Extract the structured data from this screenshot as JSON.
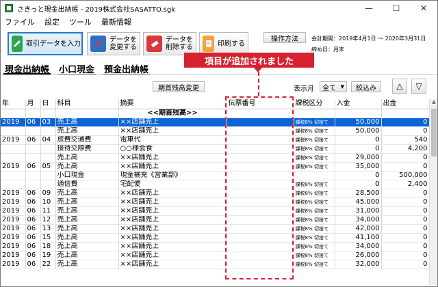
{
  "window": {
    "title": "さきっと現金出納帳 - 2019株式会社SASATTO.sgk",
    "minimize": "—",
    "maximize": "☐",
    "close": "✕"
  },
  "menu": [
    "ファイル",
    "設定",
    "ツール",
    "最新情報"
  ],
  "toolbar": {
    "input_label": "取引データを入力",
    "change_label_1": "データを",
    "change_label_2": "変更する",
    "delete_label_1": "データを",
    "delete_label_2": "削除する",
    "print_label": "印刷する",
    "help_label": "操作方法",
    "period_label": "会計期間：2019年4月1日 ～ 2020年3月31日",
    "closing_label": "締め日：月末"
  },
  "tabs": [
    "現金出納帳",
    "小口現金",
    "預金出納帳"
  ],
  "callout": "項目が追加されました",
  "controls": {
    "opening_balance_label": "期首残高変更",
    "month_label": "表示月",
    "month_value": "全て",
    "filter_label": "絞込み",
    "up_arrow": "△",
    "down_arrow": "▽"
  },
  "table": {
    "headers": [
      "年",
      "月",
      "日",
      "科目",
      "摘要",
      "伝票番号",
      "課税区分",
      "入金",
      "出金"
    ],
    "rows": [
      [
        "",
        "",
        "",
        "",
        "<<期首残高>>",
        "",
        "",
        "",
        ""
      ],
      [
        "2019",
        "06",
        "03",
        "売上高",
        "××店舗売上",
        "",
        "課税8% 切捨て",
        "50,000",
        "0"
      ],
      [
        "",
        "",
        "",
        "売上高",
        "××店舗売上",
        "",
        "課税8% 切捨て",
        "50,000",
        "0"
      ],
      [
        "2019",
        "06",
        "04",
        "旅費交通費",
        "電車代",
        "",
        "課税8% 切捨て",
        "0",
        "540"
      ],
      [
        "",
        "",
        "",
        "接待交際費",
        "○○様会食",
        "",
        "課税8% 切捨て",
        "0",
        "4,200"
      ],
      [
        "",
        "",
        "",
        "売上高",
        "××店舗売上",
        "",
        "課税8% 切捨て",
        "29,000",
        "0"
      ],
      [
        "2019",
        "06",
        "05",
        "売上高",
        "××店舗売上",
        "",
        "課税8% 切捨て",
        "35,000",
        "0"
      ],
      [
        "",
        "",
        "",
        "小口現金",
        "現金補充《営業部》",
        "",
        "",
        "0",
        "500,000"
      ],
      [
        "",
        "",
        "",
        "通信費",
        "宅配便",
        "",
        "課税8% 切捨て",
        "0",
        "2,400"
      ],
      [
        "2019",
        "06",
        "09",
        "売上高",
        "××店舗売上",
        "",
        "課税8% 切捨て",
        "28,500",
        "0"
      ],
      [
        "2019",
        "06",
        "10",
        "売上高",
        "××店舗売上",
        "",
        "課税8% 切捨て",
        "45,000",
        "0"
      ],
      [
        "2019",
        "06",
        "11",
        "売上高",
        "××店舗売上",
        "",
        "課税8% 切捨て",
        "31,000",
        "0"
      ],
      [
        "2019",
        "06",
        "12",
        "売上高",
        "××店舗売上",
        "",
        "課税8% 切捨て",
        "34,000",
        "0"
      ],
      [
        "2019",
        "06",
        "13",
        "売上高",
        "××店舗売上",
        "",
        "課税8% 切捨て",
        "42,000",
        "0"
      ],
      [
        "2019",
        "06",
        "15",
        "売上高",
        "××店舗売上",
        "",
        "課税8% 切捨て",
        "41,100",
        "0"
      ],
      [
        "2019",
        "06",
        "18",
        "売上高",
        "××店舗売上",
        "",
        "課税8% 切捨て",
        "34,000",
        "0"
      ],
      [
        "2019",
        "06",
        "19",
        "売上高",
        "××店舗売上",
        "",
        "課税8% 切捨て",
        "26,000",
        "0"
      ],
      [
        "2019",
        "06",
        "22",
        "売上高",
        "××店舗売上",
        "",
        "課税8% 切捨て",
        "32,000",
        "0"
      ]
    ],
    "selected_row": 1
  },
  "colors": {
    "accent": "#d62230",
    "selection": "#0a64d8"
  }
}
